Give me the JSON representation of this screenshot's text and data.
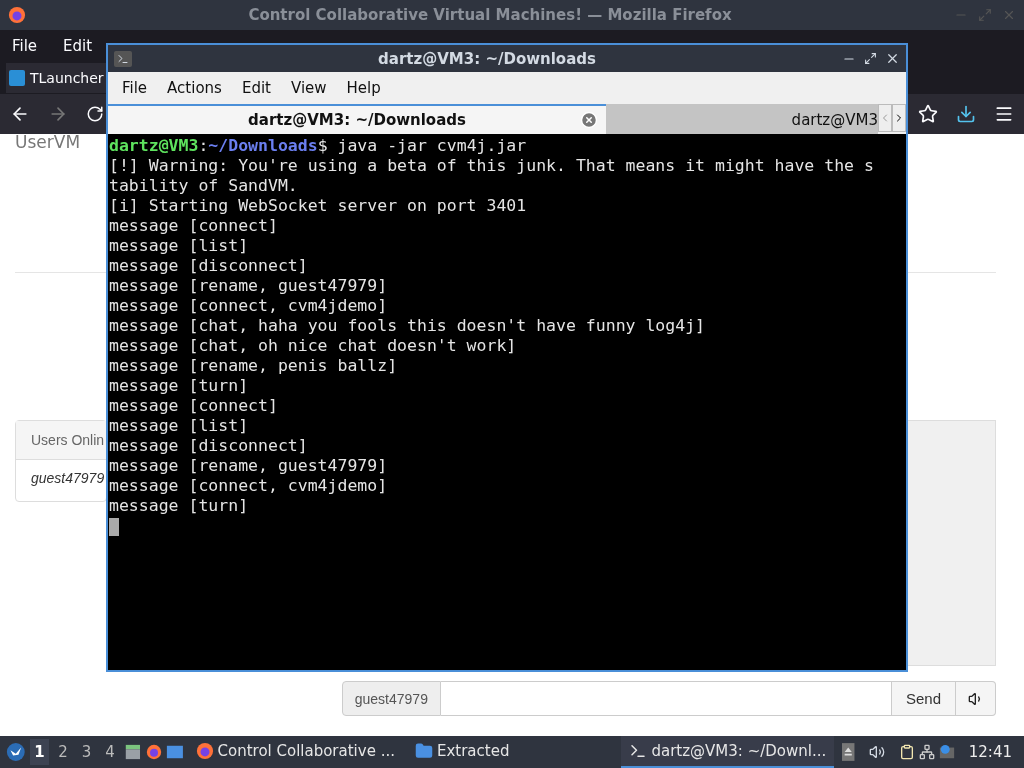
{
  "browser": {
    "title": "Control Collaborative Virtual Machines! — Mozilla Firefox",
    "menu": [
      "File",
      "Edit"
    ],
    "tabs": [
      {
        "label": "TLauncher",
        "selected": true
      }
    ],
    "page": {
      "heading": "UserVM",
      "users_panel": {
        "title": "Users Onlin",
        "users": [
          "guest47979"
        ]
      },
      "chat": {
        "username": "guest47979",
        "send": "Send"
      }
    }
  },
  "terminal": {
    "title": "dartz@VM3: ~/Downloads",
    "menu": [
      "File",
      "Actions",
      "Edit",
      "View",
      "Help"
    ],
    "tabs": [
      {
        "label": "dartz@VM3: ~/Downloads",
        "selected": true
      },
      {
        "label": "dartz@VM3",
        "selected": false
      }
    ],
    "prompt": {
      "user": "dartz@VM3",
      "separator": ":",
      "path": "~/Downloads",
      "command": "$ java -jar cvm4j.jar"
    },
    "lines": [
      "[!] Warning: You're using a beta of this junk. That means it might have the s",
      "tability of SandVM.",
      "[i] Starting WebSocket server on port 3401",
      "message [connect]",
      "message [list]",
      "message [disconnect]",
      "message [rename, guest47979]",
      "message [connect, cvm4jdemo]",
      "message [chat, haha you fools this doesn't have funny log4j]",
      "message [chat, oh nice chat doesn't work]",
      "message [rename, penis ballz]",
      "message [turn]",
      "message [connect]",
      "message [list]",
      "message [disconnect]",
      "message [rename, guest47979]",
      "message [connect, cvm4jdemo]",
      "message [turn]"
    ]
  },
  "taskbar": {
    "workspaces": [
      {
        "label": "1",
        "selected": true
      },
      {
        "label": "2",
        "selected": false
      },
      {
        "label": "3",
        "selected": false
      },
      {
        "label": "4",
        "selected": false
      }
    ],
    "tasks": [
      {
        "kind": "browser",
        "label": "Control Collaborative ...",
        "selected": false
      },
      {
        "kind": "folder",
        "label": "Extracted",
        "selected": false
      },
      {
        "kind": "terminal",
        "label": "dartz@VM3: ~/Downl...",
        "selected": true
      }
    ],
    "clock": "12:41"
  }
}
